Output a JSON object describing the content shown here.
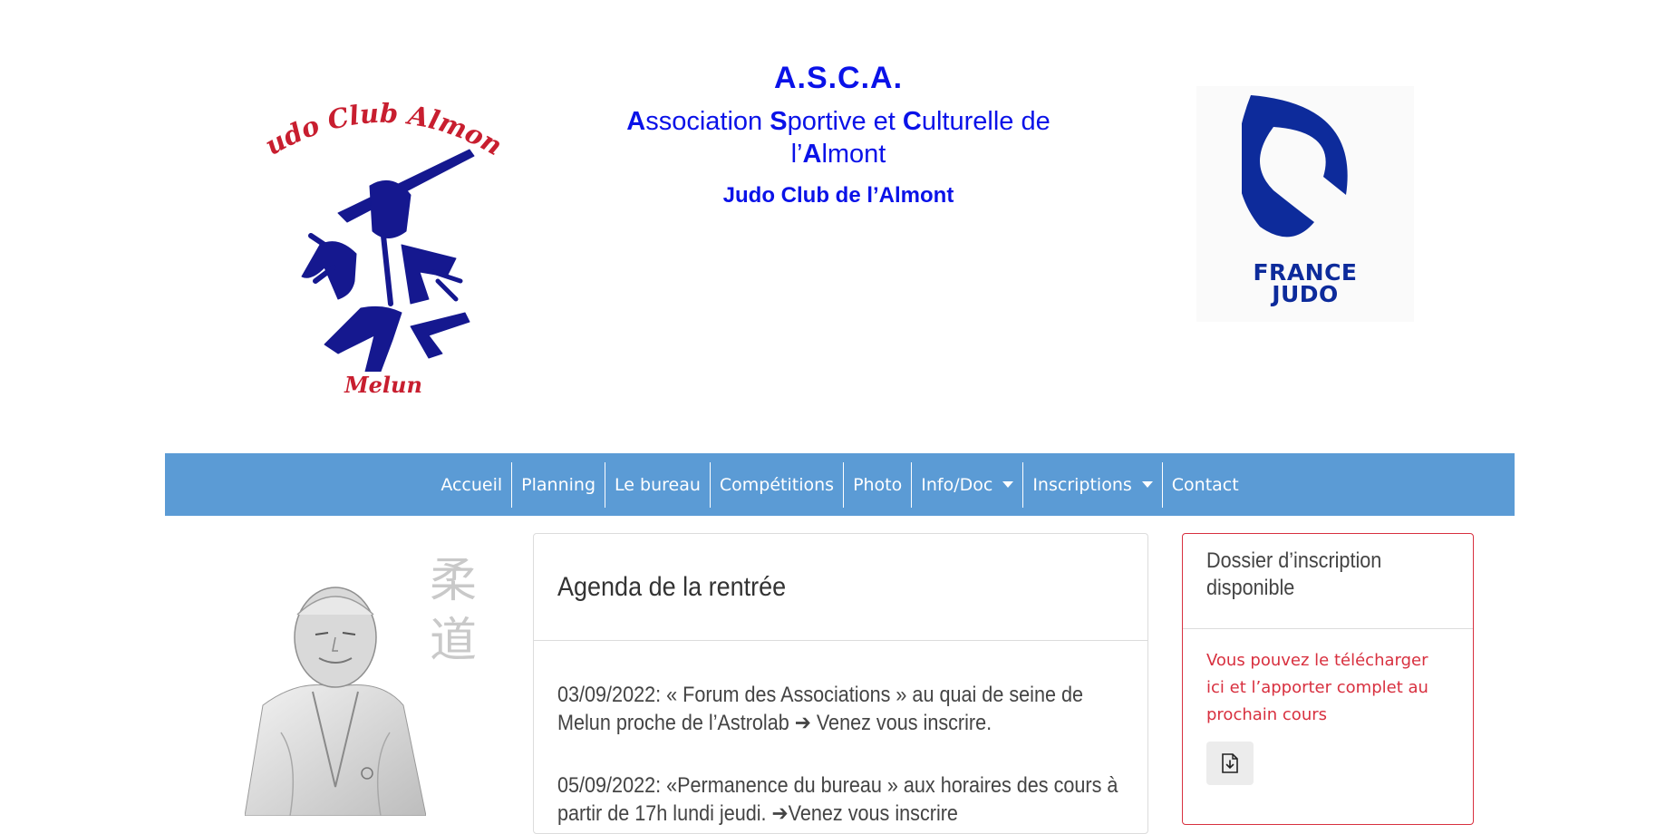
{
  "header": {
    "logo_left": {
      "arc_text": "Judo Club Almont",
      "bottom_text": "Melun"
    },
    "title": "A.S.C.A.",
    "subtitle_parts": [
      {
        "initial": "A",
        "rest": "ssociation "
      },
      {
        "initial": "S",
        "rest": "portive et "
      },
      {
        "initial": "C",
        "rest": "ulturelle de"
      }
    ],
    "subtitle_line2_prefix": "l’",
    "subtitle_line2_initial": "A",
    "subtitle_line2_rest": "lmont",
    "club_name": "Judo Club de l’Almont",
    "logo_right": {
      "line1": "FRANCE",
      "line2": "JUDO"
    }
  },
  "nav": {
    "items": [
      {
        "label": "Accueil"
      },
      {
        "label": "Planning"
      },
      {
        "label": "Le bureau"
      },
      {
        "label": "Compétitions"
      },
      {
        "label": "Photo"
      },
      {
        "label": "Info/Doc",
        "dropdown": true
      },
      {
        "label": "Inscriptions",
        "dropdown": true
      },
      {
        "label": "Contact"
      }
    ]
  },
  "portrait": {
    "kanji": [
      "柔",
      "道"
    ]
  },
  "main_card": {
    "title": "Agenda de la rentrée",
    "paragraphs": [
      "03/09/2022: « Forum des Associations » au quai de seine de Melun proche de l’Astrolab ➔ Venez vous inscrire.",
      "05/09/2022: «Permanence du bureau » aux horaires des cours à partir de 17h lundi jeudi. ➔Venez vous inscrire"
    ]
  },
  "side_card": {
    "title": "Dossier d’inscription disponible",
    "body": "Vous pouvez le télécharger ici et l’apporter complet au prochain cours",
    "button_icon": "file-download-icon"
  },
  "colors": {
    "nav_bg": "#5b9bd5",
    "brand_blue": "#0a12e8",
    "logo_red": "#c81e2f",
    "logo_navy": "#15188f",
    "france_judo_blue": "#0d2b9b",
    "accent_red": "#d8303f"
  }
}
